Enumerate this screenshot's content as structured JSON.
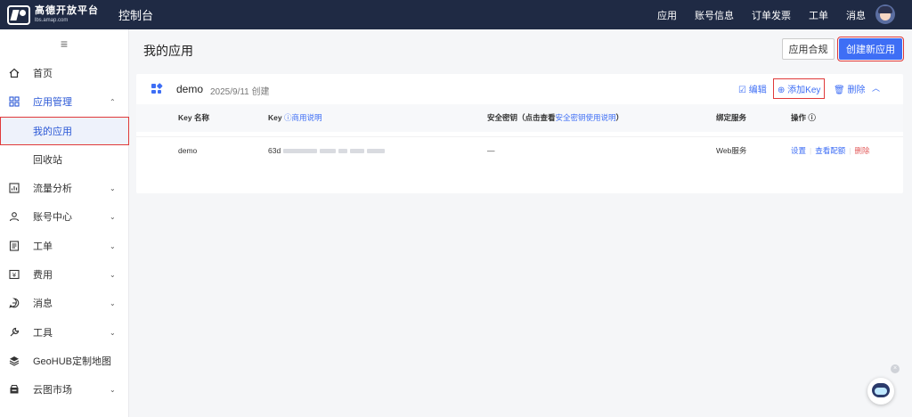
{
  "topbar": {
    "logo_name": "高德开放平台",
    "logo_domain": "lbs.amap.com",
    "console_title": "控制台",
    "nav": [
      "应用",
      "账号信息",
      "订单发票",
      "工单",
      "消息"
    ]
  },
  "sidebar": {
    "toggle_icon": "menu-icon",
    "items": [
      {
        "label": "首页",
        "icon": "home-icon"
      },
      {
        "label": "应用管理",
        "icon": "apps-icon",
        "chevron": "⌃"
      },
      {
        "label": "我的应用"
      },
      {
        "label": "回收站"
      },
      {
        "label": "流量分析",
        "icon": "chart-icon",
        "chevron": "⌄"
      },
      {
        "label": "账号中心",
        "icon": "user-icon",
        "chevron": "⌄"
      },
      {
        "label": "工单",
        "icon": "ticket-icon",
        "chevron": "⌄"
      },
      {
        "label": "费用",
        "icon": "billing-icon",
        "chevron": "⌄"
      },
      {
        "label": "消息",
        "icon": "message-icon",
        "chevron": "⌄"
      },
      {
        "label": "工具",
        "icon": "tool-icon",
        "chevron": "⌄"
      },
      {
        "label": "GeoHUB定制地图",
        "icon": "layers-icon"
      },
      {
        "label": "云图市场",
        "icon": "market-icon",
        "chevron": "⌄"
      }
    ]
  },
  "main": {
    "title": "我的应用",
    "compliance_button": "应用合规",
    "create_button": "创建新应用",
    "app": {
      "name": "demo",
      "created": "2025/9/11 创建",
      "actions": {
        "edit": "编辑",
        "add_key": "添加Key",
        "delete": "删除"
      }
    },
    "table": {
      "headers": {
        "key_name": "Key 名称",
        "key": "Key",
        "key_help": "商用说明",
        "secret_prefix": "安全密钥（点击查看",
        "secret_link": "安全密钥使用说明",
        "secret_suffix": "）",
        "service": "绑定服务",
        "ops": "操作"
      },
      "rows": [
        {
          "key_name": "demo",
          "key": "63d",
          "secret": "—",
          "service": "Web服务",
          "ops": {
            "settings": "设置",
            "config": "查看配额",
            "delete": "删除"
          }
        }
      ]
    }
  },
  "colors": {
    "accent": "#3e6ef5",
    "topbar": "#1f2a44",
    "highlight": "#e03a3a",
    "danger": "#e25b5b"
  }
}
